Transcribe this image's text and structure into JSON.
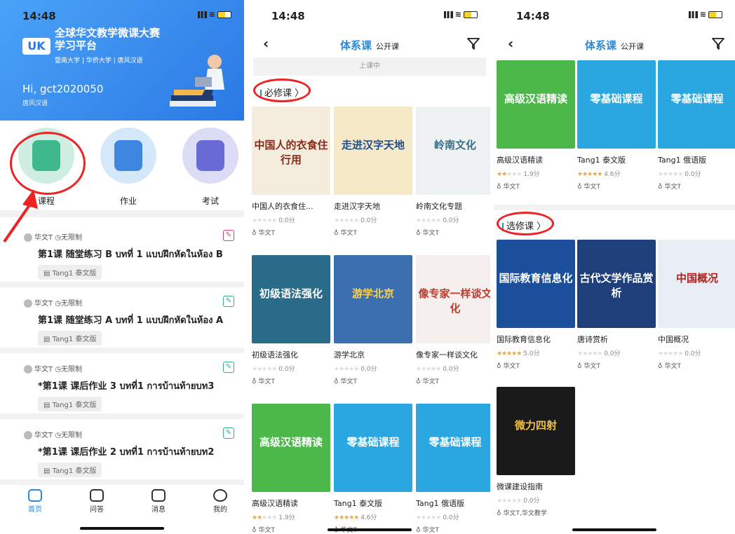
{
  "status_time": "14:48",
  "p1": {
    "logo_text": "UK",
    "banner_title": "全球华文教学微课大赛\n学习平台",
    "banner_sub": "暨南大学 | 华侨大学 | 唐风汉语",
    "greeting": "Hi, gct2020050",
    "brand_small": "唐风汉语",
    "features": [
      {
        "label": "课程",
        "color": "#3fb88e",
        "bg": "#cdeee0"
      },
      {
        "label": "作业",
        "color": "#3f86e0",
        "bg": "#d5e8fa"
      },
      {
        "label": "考试",
        "color": "#6b6bd8",
        "bg": "#dcdcf6"
      }
    ],
    "tasks": [
      {
        "author": "华文T",
        "limit": "无限制",
        "title": "第1课 随堂练习 B บทที่ 1 แบบฝึกหัดในห้อง B",
        "tag": "Tang1 泰文版",
        "badge_color": "#e0456e"
      },
      {
        "author": "华文T",
        "limit": "无限制",
        "title": "第1课 随堂练习 A บทที่ 1 แบบฝึกหัดในห้อง A",
        "tag": "Tang1 泰文版",
        "badge_color": "#2fb08a"
      },
      {
        "author": "华文T",
        "limit": "无限制",
        "title": "*第1课 课后作业 3 บทที่1 การบ้านท้ายบท3",
        "tag": "Tang1 泰文版",
        "badge_color": "#2fb08a"
      },
      {
        "author": "华文T",
        "limit": "无限制",
        "title": "*第1课 课后作业 2 บทที่1 การบ้านท้ายบท2",
        "tag": "Tang1 泰文版",
        "badge_color": "#2fb08a"
      }
    ],
    "tabs": [
      "首页",
      "问答",
      "消息",
      "我的"
    ]
  },
  "nav": {
    "back": "‹",
    "active_tab": "体系课",
    "other_tab": "公开课"
  },
  "p2": {
    "status_text": "上课中",
    "section": "必修课 〉",
    "courses": [
      {
        "name": "中国人的衣食住...",
        "stars": "★★★★★",
        "filled": 0,
        "score": "0.0分",
        "author": "华文T",
        "cover_bg": "#f4ecdc",
        "cover_text": "中国人的衣食住行用",
        "cover_color": "#8a2a1a"
      },
      {
        "name": "走进汉字天地",
        "stars": "★★★★★",
        "filled": 0,
        "score": "0.0分",
        "author": "华文T",
        "cover_bg": "#f6e9c8",
        "cover_text": "走进汉字天地",
        "cover_color": "#1f4f8c"
      },
      {
        "name": "岭南文化专题",
        "stars": "★★★★★",
        "filled": 0,
        "score": "0.0分",
        "author": "华文T",
        "cover_bg": "#eef2f3",
        "cover_text": "岭南文化",
        "cover_color": "#3a6f8a"
      },
      {
        "name": "初级语法强化",
        "stars": "★★★★★",
        "filled": 0,
        "score": "0.0分",
        "author": "华文T",
        "cover_bg": "#2a6b8a",
        "cover_text": "初级语法强化",
        "cover_color": "#ffffff"
      },
      {
        "name": "游学北京",
        "stars": "★★★★★",
        "filled": 0,
        "score": "0.0分",
        "author": "华文T",
        "cover_bg": "#3b6fb0",
        "cover_text": "游学北京",
        "cover_color": "#ffd34a"
      },
      {
        "name": "像专家一样谈文化",
        "stars": "★★★★★",
        "filled": 0,
        "score": "0.0分",
        "author": "华文T",
        "cover_bg": "#f5f0ee",
        "cover_text": "像专家一样谈文化",
        "cover_color": "#c0392b"
      },
      {
        "name": "高级汉语精读",
        "stars": "★★★★★",
        "filled": 2,
        "score": "1.9分",
        "author": "华文T",
        "cover_bg": "#4cb84a",
        "cover_text": "高级汉语精读",
        "cover_color": "#ffffff"
      },
      {
        "name": "Tang1 泰文版",
        "stars": "★★★★★",
        "filled": 5,
        "score": "4.6分",
        "author": "华文T",
        "cover_bg": "#2aa7e0",
        "cover_text": "零基础课程",
        "cover_color": "#ffffff"
      },
      {
        "name": "Tang1 俄语版",
        "stars": "★★★★★",
        "filled": 0,
        "score": "0.0分",
        "author": "华文T",
        "cover_bg": "#2aa7e0",
        "cover_text": "零基础课程",
        "cover_color": "#ffffff"
      }
    ]
  },
  "p3": {
    "top_courses": [
      {
        "name": "高级汉语精读",
        "stars": "★★★★★",
        "filled": 2,
        "score": "1.9分",
        "author": "华文T",
        "cover_bg": "#4cb84a",
        "cover_text": "高级汉语精读",
        "cover_color": "#ffffff"
      },
      {
        "name": "Tang1 泰文版",
        "stars": "★★★★★",
        "filled": 5,
        "score": "4.6分",
        "author": "华文T",
        "cover_bg": "#2aa7e0",
        "cover_text": "零基础课程",
        "cover_color": "#ffffff"
      },
      {
        "name": "Tang1 俄语版",
        "stars": "★★★★★",
        "filled": 0,
        "score": "0.0分",
        "author": "华文T",
        "cover_bg": "#2aa7e0",
        "cover_text": "零基础课程",
        "cover_color": "#ffffff"
      }
    ],
    "section": "选修课 〉",
    "elective": [
      {
        "name": "国际教育信息化",
        "stars": "★★★★★",
        "filled": 5,
        "score": "5.0分",
        "author": "华文T",
        "cover_bg": "#1b4f9c",
        "cover_text": "国际教育信息化",
        "cover_color": "#ffffff"
      },
      {
        "name": "唐诗赏析",
        "stars": "★★★★★",
        "filled": 0,
        "score": "0.0分",
        "author": "华文T",
        "cover_bg": "#1f3f7a",
        "cover_text": "古代文学作品赏析",
        "cover_color": "#ffffff"
      },
      {
        "name": "中国概况",
        "stars": "★★★★★",
        "filled": 0,
        "score": "0.0分",
        "author": "华文T",
        "cover_bg": "#e8eef4",
        "cover_text": "中国概况",
        "cover_color": "#b02020"
      },
      {
        "name": "微课建设指南",
        "stars": "★★★★★",
        "filled": 0,
        "score": "0.0分",
        "author": "华文T,华文教学",
        "cover_bg": "#1a1a1a",
        "cover_text": "微力四射",
        "cover_color": "#f0c040"
      }
    ]
  }
}
